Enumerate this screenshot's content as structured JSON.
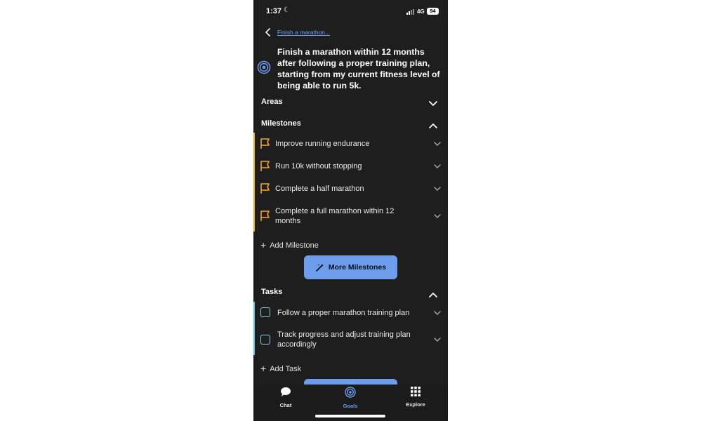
{
  "status_bar": {
    "time": "1:37",
    "network": "4G",
    "battery": "94"
  },
  "header": {
    "breadcrumb": "Finish a marathon..."
  },
  "goal": {
    "title": "Finish a marathon within 12 months after following a proper training plan, starting from my current fitness level of being able to run 5k."
  },
  "sections": {
    "areas": {
      "label": "Areas"
    },
    "milestones": {
      "label": "Milestones",
      "items": [
        {
          "label": "Improve running endurance"
        },
        {
          "label": "Run 10k without stopping"
        },
        {
          "label": "Complete a half marathon"
        },
        {
          "label": "Complete a full marathon within 12 months"
        }
      ],
      "add_label": "Add Milestone",
      "more_button": "More Milestones"
    },
    "tasks": {
      "label": "Tasks",
      "items": [
        {
          "label": "Follow a proper marathon training plan"
        },
        {
          "label": "Track progress and adjust training plan accordingly"
        }
      ],
      "add_label": "Add Task"
    }
  },
  "tabbar": {
    "tabs": [
      {
        "label": "Chat",
        "icon": "chat-bubble-icon"
      },
      {
        "label": "Goals",
        "icon": "target-icon",
        "active": true
      },
      {
        "label": "Explore",
        "icon": "grid-icon"
      }
    ]
  },
  "colors": {
    "background": "#1e1e1e",
    "accent": "#6d9eeb",
    "milestone": "#f5a623",
    "task": "#5bc8e6"
  }
}
